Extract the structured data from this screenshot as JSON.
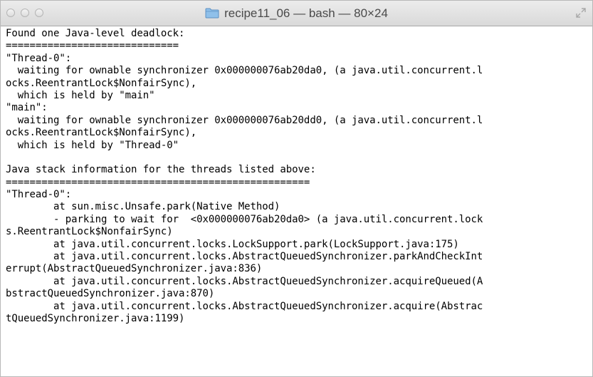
{
  "window": {
    "title": "recipe11_06 — bash — 80×24",
    "title_icon": "folder-icon",
    "buttons": [
      "close-icon",
      "minimize-icon",
      "zoom-icon"
    ],
    "fullscreen_icon": "fullscreen-icon"
  },
  "terminal": {
    "lines": [
      "Found one Java-level deadlock:",
      "=============================",
      "\"Thread-0\":",
      "  waiting for ownable synchronizer 0x000000076ab20da0, (a java.util.concurrent.l",
      "ocks.ReentrantLock$NonfairSync),",
      "  which is held by \"main\"",
      "\"main\":",
      "  waiting for ownable synchronizer 0x000000076ab20dd0, (a java.util.concurrent.l",
      "ocks.ReentrantLock$NonfairSync),",
      "  which is held by \"Thread-0\"",
      "",
      "Java stack information for the threads listed above:",
      "===================================================",
      "\"Thread-0\":",
      "        at sun.misc.Unsafe.park(Native Method)",
      "        - parking to wait for  <0x000000076ab20da0> (a java.util.concurrent.lock",
      "s.ReentrantLock$NonfairSync)",
      "        at java.util.concurrent.locks.LockSupport.park(LockSupport.java:175)",
      "        at java.util.concurrent.locks.AbstractQueuedSynchronizer.parkAndCheckInt",
      "errupt(AbstractQueuedSynchronizer.java:836)",
      "        at java.util.concurrent.locks.AbstractQueuedSynchronizer.acquireQueued(A",
      "bstractQueuedSynchronizer.java:870)",
      "        at java.util.concurrent.locks.AbstractQueuedSynchronizer.acquire(Abstrac",
      "tQueuedSynchronizer.java:1199)"
    ]
  }
}
